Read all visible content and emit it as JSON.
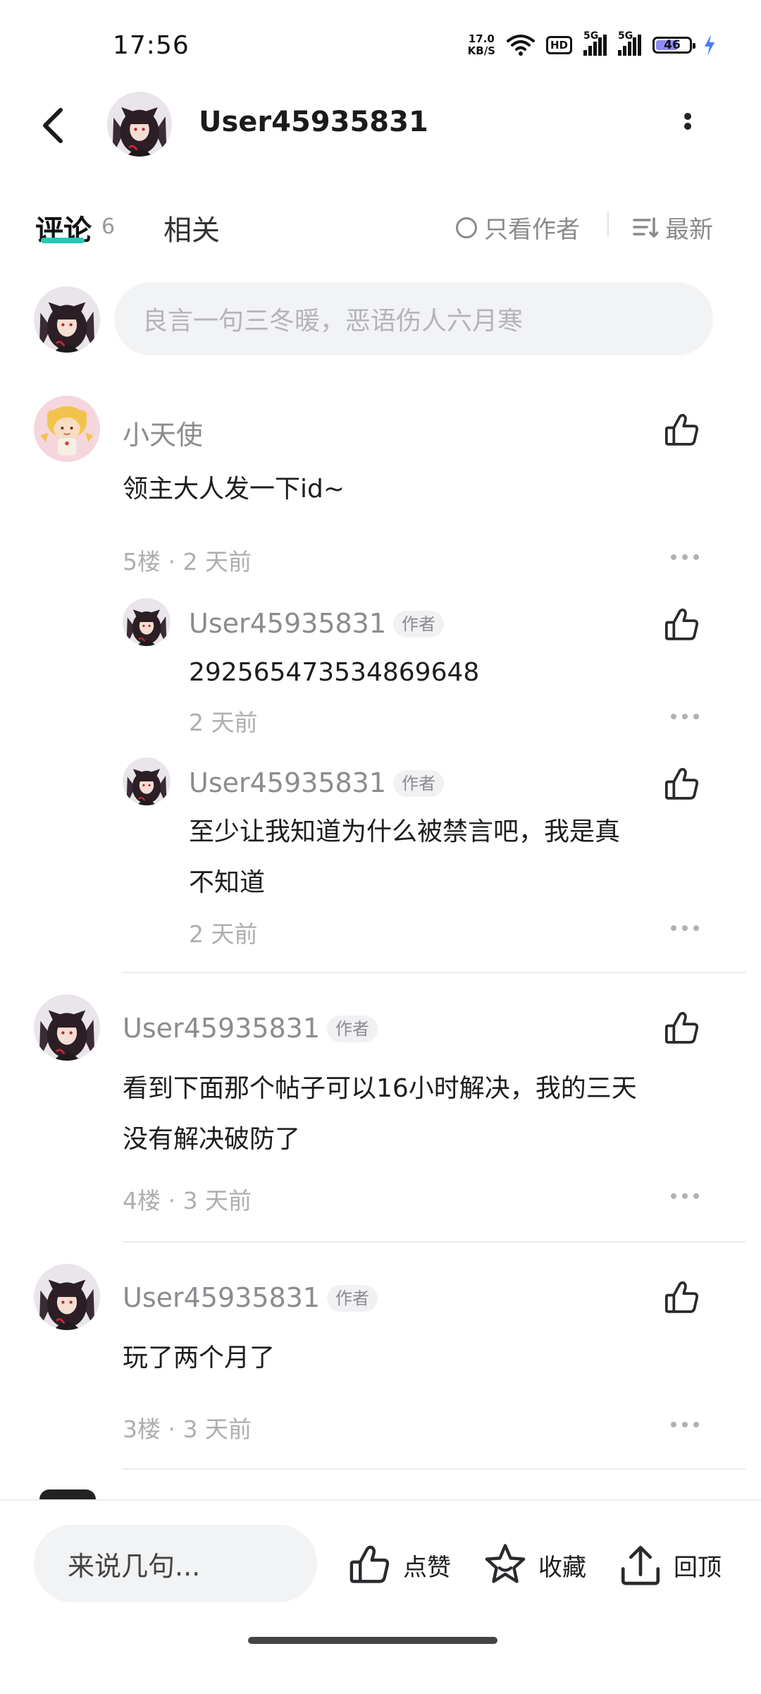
{
  "status_bar": {
    "time": "17:56",
    "speed_value": "17.0",
    "speed_unit": "KB/S",
    "hd_label": "HD",
    "signal1_label": "5G",
    "signal2_label": "5G",
    "battery": "46"
  },
  "header": {
    "username": "User45935831"
  },
  "tabs": {
    "comments_label": "评论",
    "comments_count": "6",
    "related_label": "相关",
    "author_only_label": "只看作者",
    "sort_label": "最新"
  },
  "comment_input": {
    "placeholder": "良言一句三冬暖，恶语伤人六月寒"
  },
  "comments": [
    {
      "name": "小天使",
      "text": "领主大人发一下id~",
      "meta": "5楼 · 2 天前",
      "replies": [
        {
          "name": "User45935831",
          "badge": "作者",
          "text": "2925654735348696​48",
          "meta": "2 天前"
        },
        {
          "name": "User45935831",
          "badge": "作者",
          "text_line1": "至少让我知道为什么被禁言吧，我是真",
          "text_line2": "不知道",
          "meta": "2 天前"
        }
      ]
    },
    {
      "name": "User45935831",
      "badge": "作者",
      "text_line1": "看到下面那个帖子可以16小时解决，我的三天",
      "text_line2": "没有解决破防了",
      "meta": "4楼 · 3 天前"
    },
    {
      "name": "User45935831",
      "badge": "作者",
      "text": "玩了两个月了",
      "meta": "3楼 · 3 天前"
    }
  ],
  "bottom_bar": {
    "reply_placeholder": "来说几句...",
    "like_label": "点赞",
    "favorite_label": "收藏",
    "top_label": "回顶"
  },
  "colors": {
    "accent": "#26c9b5",
    "text_primary": "#1d1d1f",
    "text_secondary": "#8b8b90"
  }
}
